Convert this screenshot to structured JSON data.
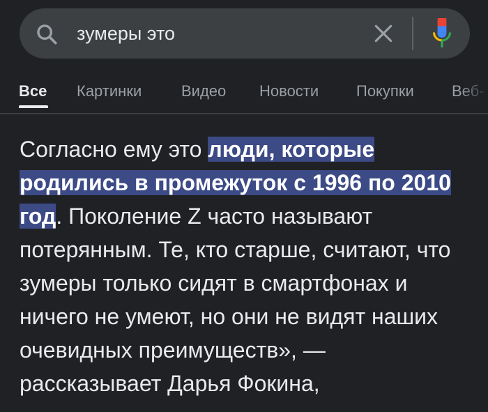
{
  "search": {
    "query": "зумеры это",
    "search_icon": "search-icon",
    "clear_icon": "close-icon",
    "mic_icon": "mic-icon",
    "colors": {
      "mic_red": "#ea4335",
      "mic_yellow": "#fbbc04",
      "mic_green": "#34a853",
      "mic_blue": "#4285f4"
    }
  },
  "tabs": [
    {
      "label": "Все",
      "active": true
    },
    {
      "label": "Картинки",
      "active": false
    },
    {
      "label": "Видео",
      "active": false
    },
    {
      "label": "Новости",
      "active": false
    },
    {
      "label": "Покупки",
      "active": false
    },
    {
      "label": "Веб-",
      "active": false
    }
  ],
  "snippet": {
    "text_before": "Согласно ему это ",
    "highlight": "люди, которые родились в промежуток с 1996 по 2010 год",
    "text_after": ". Поколение Z часто называют потерянным. Те, кто старше, считают, что зумеры только сидят в смартфонах и ничего не умеют, но они не видят наших очевидных преимуществ», — рассказывает Дарья Фокина,",
    "highlight_color": "#3c4a86"
  }
}
